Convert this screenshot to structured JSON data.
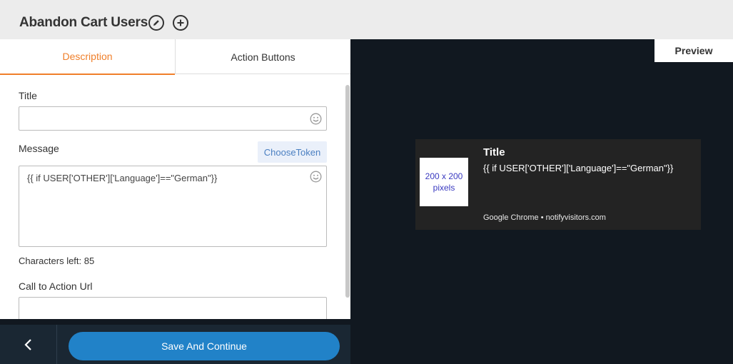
{
  "header": {
    "title": "Abandon Cart Users"
  },
  "tabs": [
    {
      "label": "Description",
      "active": true
    },
    {
      "label": "Action Buttons",
      "active": false
    }
  ],
  "form": {
    "title_label": "Title",
    "title_value": "",
    "message_label": "Message",
    "choose_token_label": "ChooseToken",
    "message_value": "{{ if USER['OTHER']['Language']==\"German\"}}",
    "characters_left": "Characters left: 85",
    "cta_label": "Call to Action Url",
    "cta_value": ""
  },
  "footer": {
    "save_label": "Save And Continue"
  },
  "preview": {
    "label": "Preview",
    "image_placeholder": "200 x 200\npixels",
    "title": "Title",
    "message": "{{ if USER['OTHER']['Language']==\"German\"}}",
    "source": "Google Chrome • notifyvisitors.com"
  },
  "colors": {
    "accent": "#f07f2a",
    "primary_button": "#2182c8",
    "preview_bg": "#111820",
    "footer_bg": "#1a2733"
  }
}
